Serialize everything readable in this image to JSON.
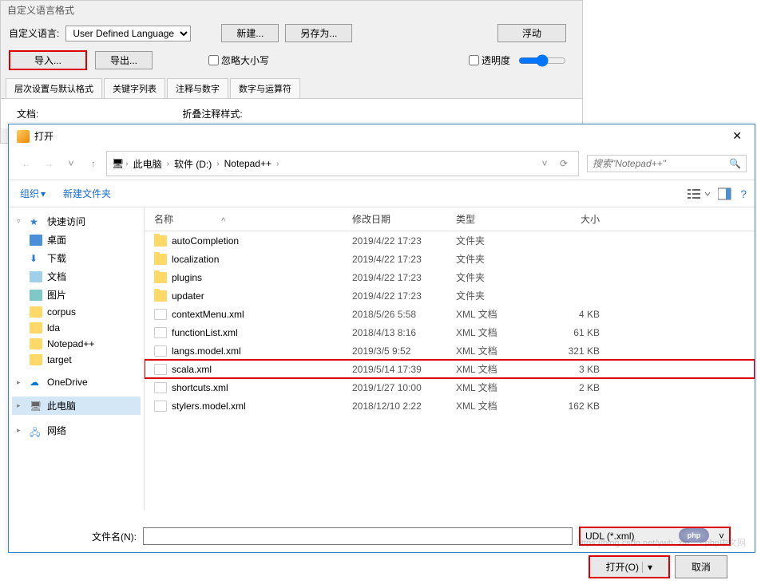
{
  "udl": {
    "window_title": "自定义语言格式",
    "lang_label": "自定义语言:",
    "lang_select": "User Defined Language",
    "new_btn": "新建...",
    "saveas_btn": "另存为...",
    "float_btn": "浮动",
    "import_btn": "导入...",
    "export_btn": "导出...",
    "ignore_case": "忽略大小写",
    "transparency": "透明度",
    "tabs": [
      "层次设置与默认格式",
      "关键字列表",
      "注释与数字",
      "数字与运算符"
    ],
    "panel_doc": "文档:",
    "panel_fold": "折叠注释样式:"
  },
  "dialog": {
    "title": "打开",
    "breadcrumb": [
      "此电脑",
      "软件 (D:)",
      "Notepad++"
    ],
    "search_placeholder": "搜索\"Notepad++\"",
    "organize": "组织",
    "new_folder": "新建文件夹",
    "columns": {
      "name": "名称",
      "date": "修改日期",
      "type": "类型",
      "size": "大小"
    },
    "sidebar": {
      "quick_access": "快速访问",
      "desktop": "桌面",
      "downloads": "下载",
      "documents": "文档",
      "pictures": "图片",
      "corpus": "corpus",
      "lda": "lda",
      "notepadpp": "Notepad++",
      "target": "target",
      "onedrive": "OneDrive",
      "this_pc": "此电脑",
      "network": "网络"
    },
    "files": [
      {
        "name": "autoCompletion",
        "date": "2019/4/22 17:23",
        "type": "文件夹",
        "size": "",
        "kind": "folder"
      },
      {
        "name": "localization",
        "date": "2019/4/22 17:23",
        "type": "文件夹",
        "size": "",
        "kind": "folder"
      },
      {
        "name": "plugins",
        "date": "2019/4/22 17:23",
        "type": "文件夹",
        "size": "",
        "kind": "folder"
      },
      {
        "name": "updater",
        "date": "2019/4/22 17:23",
        "type": "文件夹",
        "size": "",
        "kind": "folder"
      },
      {
        "name": "contextMenu.xml",
        "date": "2018/5/26 5:58",
        "type": "XML 文档",
        "size": "4 KB",
        "kind": "xml"
      },
      {
        "name": "functionList.xml",
        "date": "2018/4/13 8:16",
        "type": "XML 文档",
        "size": "61 KB",
        "kind": "xml"
      },
      {
        "name": "langs.model.xml",
        "date": "2019/3/5 9:52",
        "type": "XML 文档",
        "size": "321 KB",
        "kind": "xml"
      },
      {
        "name": "scala.xml",
        "date": "2019/5/14 17:39",
        "type": "XML 文档",
        "size": "3 KB",
        "kind": "xml",
        "highlighted": true
      },
      {
        "name": "shortcuts.xml",
        "date": "2019/1/27 10:00",
        "type": "XML 文档",
        "size": "2 KB",
        "kind": "xml"
      },
      {
        "name": "stylers.model.xml",
        "date": "2018/12/10 2:22",
        "type": "XML 文档",
        "size": "162 KB",
        "kind": "xml"
      }
    ],
    "filename_label": "文件名(N):",
    "filename_value": "",
    "filetype": "UDL (*.xml)",
    "open_btn": "打开(O)",
    "cancel_btn": "取消"
  },
  "watermark": "https://blog.csdn.net/ywh_zte... · php中文网"
}
